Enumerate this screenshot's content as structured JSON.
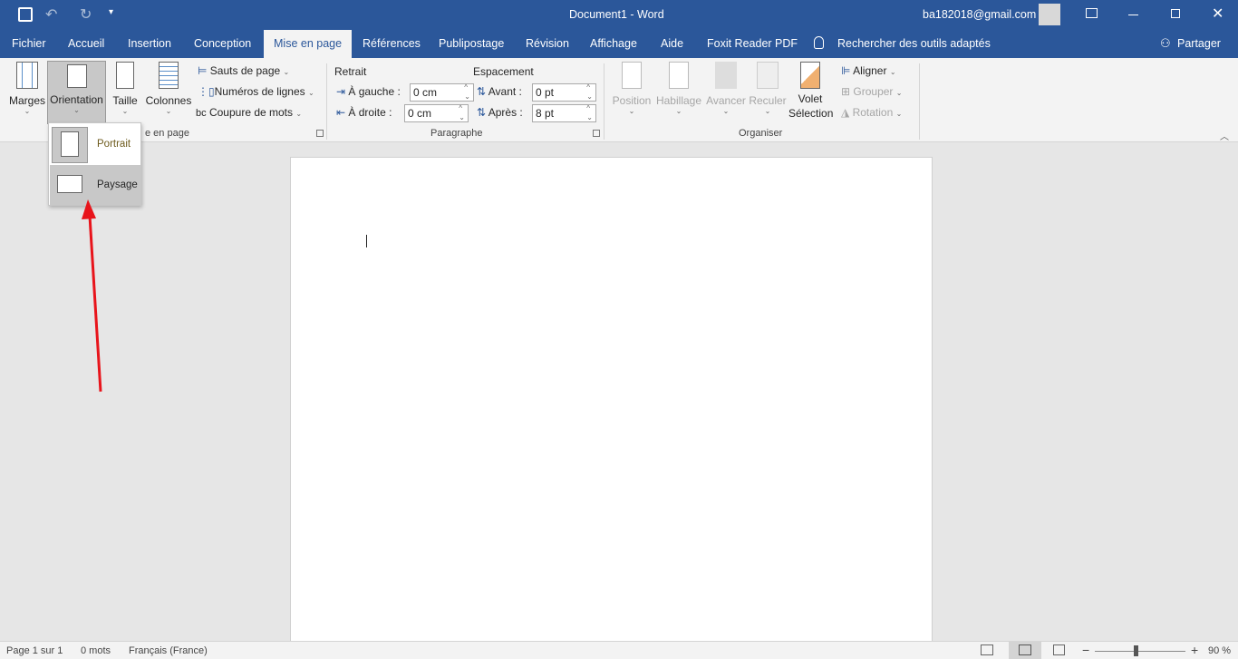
{
  "titlebar": {
    "title": "Document1 - Word",
    "account": "ba182018@gmail.com"
  },
  "tabs": [
    "Fichier",
    "Accueil",
    "Insertion",
    "Conception",
    "Mise en page",
    "Références",
    "Publipostage",
    "Révision",
    "Affichage",
    "Aide",
    "Foxit Reader PDF"
  ],
  "active_tab": "Mise en page",
  "search": "Rechercher des outils adaptés",
  "share": "Partager",
  "ribbon": {
    "mise_en_page": {
      "marges": "Marges",
      "orientation": "Orientation",
      "taille": "Taille",
      "colonnes": "Colonnes",
      "sauts": "Sauts de page",
      "numeros": "Numéros de lignes",
      "coupure": "Coupure de mots",
      "group": "Mise en page",
      "group_visible": "e en page"
    },
    "paragraphe": {
      "retrait": "Retrait",
      "espacement": "Espacement",
      "gauche_label": "À gauche :",
      "gauche_value": "0 cm",
      "droite_label": "À droite :",
      "droite_value": "0 cm",
      "avant_label": "Avant :",
      "avant_value": "0 pt",
      "apres_label": "Après :",
      "apres_value": "8 pt",
      "group": "Paragraphe"
    },
    "organiser": {
      "position": "Position",
      "habillage": "Habillage",
      "avancer": "Avancer",
      "reculer": "Reculer",
      "volet1": "Volet",
      "volet2": "Sélection",
      "aligner": "Aligner",
      "grouper": "Grouper",
      "rotation": "Rotation",
      "group": "Organiser"
    }
  },
  "dropdown": {
    "items": [
      "Portrait",
      "Paysage"
    ],
    "hovered": "Paysage"
  },
  "status": {
    "page": "Page 1 sur 1",
    "words": "0 mots",
    "lang": "Français (France)",
    "zoom": "90 %",
    "zoom_percent": 90
  },
  "colors": {
    "accent": "#2b579a",
    "arrow": "#e8141b"
  }
}
